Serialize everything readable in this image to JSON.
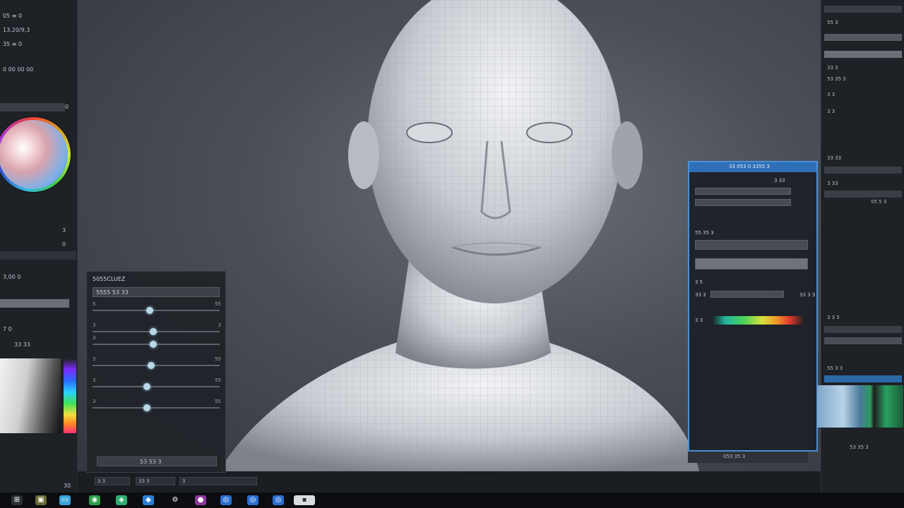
{
  "viewport": {
    "accent": "#4a8fd8"
  },
  "left_panel": {
    "rows": [
      "05 ≡ 0",
      "13,20/9,3",
      "35 ≡ 0",
      "0 00 00 00"
    ],
    "tool_row": "30",
    "values": [
      "0",
      "3",
      "0",
      "30"
    ],
    "labels": [
      "3,00 0",
      "7 0",
      "33 33"
    ]
  },
  "brush_panel": {
    "title": "5055CLUEZ",
    "dropdown": "5555 53 33",
    "sliders": [
      {
        "label": "5",
        "value": "55",
        "level": 0.45
      },
      {
        "label": "3",
        "value": "3",
        "level": 0.48
      },
      {
        "label": "3",
        "value": "",
        "level": 0.48
      },
      {
        "label": "3",
        "value": "55",
        "level": 0.46
      },
      {
        "label": "3",
        "value": "55",
        "level": 0.43
      },
      {
        "label": "3",
        "value": "55",
        "level": 0.43
      }
    ],
    "footer_button": "53 53 3"
  },
  "props_panel": {
    "header": "33 053 0 3355 3",
    "rows": [
      "3 33",
      "55 35 3",
      "3 5",
      "33 3",
      "33 3 3"
    ],
    "gradient_label": "3 3"
  },
  "right_panel": {
    "rows": [
      "55 3",
      "33 3",
      "53 35 3",
      "3 3",
      "3 3",
      "33 33",
      "3 33",
      "55 5 3",
      "3 3 5",
      "55 3 3",
      "53 35 3"
    ]
  },
  "bottom": {
    "apply_label": "053 35 3",
    "tabs": [
      "3 3",
      "33 3",
      "3"
    ]
  },
  "taskbar": {
    "icons": [
      "windows-icon",
      "folder-icon",
      "app-icon-1",
      "app-icon-2",
      "app-icon-3",
      "settings-icon",
      "app-icon-4",
      "app-icon-5",
      "app-icon-6",
      "app-icon-7",
      "app-icon-8"
    ]
  }
}
